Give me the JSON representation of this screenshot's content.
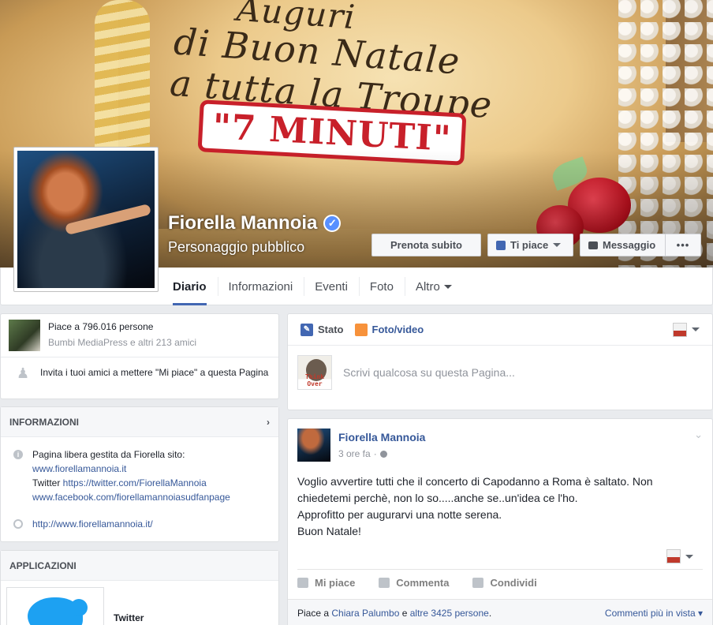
{
  "cover": {
    "script_line1": "Auguri",
    "script_line2": "di Buon Natale",
    "script_line3": "a tutta la Troupe",
    "banner_text": "\"7 MINUTI\""
  },
  "page": {
    "name": "Fiorella Mannoia",
    "category": "Personaggio pubblico",
    "verified_icon": "verified-badge-icon"
  },
  "buttons": {
    "book": "Prenota subito",
    "like": "Ti piace",
    "message": "Messaggio",
    "more": "•••"
  },
  "tabs": [
    {
      "label": "Diario",
      "active": true
    },
    {
      "label": "Informazioni"
    },
    {
      "label": "Eventi"
    },
    {
      "label": "Foto"
    },
    {
      "label": "Altro"
    }
  ],
  "likes": {
    "count_text": "Piace a 796.016 persone",
    "friends_text": "Bumbi MediaPress e altri 213 amici",
    "invite_text": "Invita i tuoi amici a mettere \"Mi piace\" a questa Pagina"
  },
  "info": {
    "title": "INFORMAZIONI",
    "line1": "Pagina libera gestita da Fiorella sito:",
    "site_link": "www.fiorellamannoia.it",
    "twitter_label": "Twitter ",
    "twitter_link": "https://twitter.com/FiorellaMannoia",
    "facebook_link": "www.facebook.com/fiorellamannoiasudfanpage",
    "website": "http://www.fiorellamannoia.it/"
  },
  "apps": {
    "title": "APPLICAZIONI",
    "twitter_name": "Twitter"
  },
  "composer": {
    "tab_status": "Stato",
    "tab_photo": "Foto/video",
    "placeholder": "Scrivi qualcosa su questa Pagina...",
    "avatar_label": "Think Over"
  },
  "post": {
    "author": "Fiorella Mannoia",
    "time": "3 ore fa",
    "text_line1": "Voglio avvertire tutti che il concerto di Capodanno a Roma è saltato. Non",
    "text_line2": "chiedetemi perchè, non lo so.....anche se..un'idea ce l'ho.",
    "text_line3": "Approfitto per augurarvi una notte serena.",
    "text_line4": "Buon Natale!",
    "action_like": "Mi piace",
    "action_comment": "Commenta",
    "action_share": "Condividi",
    "likers_prefix": "Piace a ",
    "liker_name": "Chiara Palumbo",
    "likers_middle": " e ",
    "likers_others": "altre 3425 persone",
    "likers_suffix": ".",
    "comments_link": "Commenti più in vista"
  },
  "colors": {
    "brand": "#4267b2",
    "link": "#365899",
    "background": "#e9ebee"
  }
}
